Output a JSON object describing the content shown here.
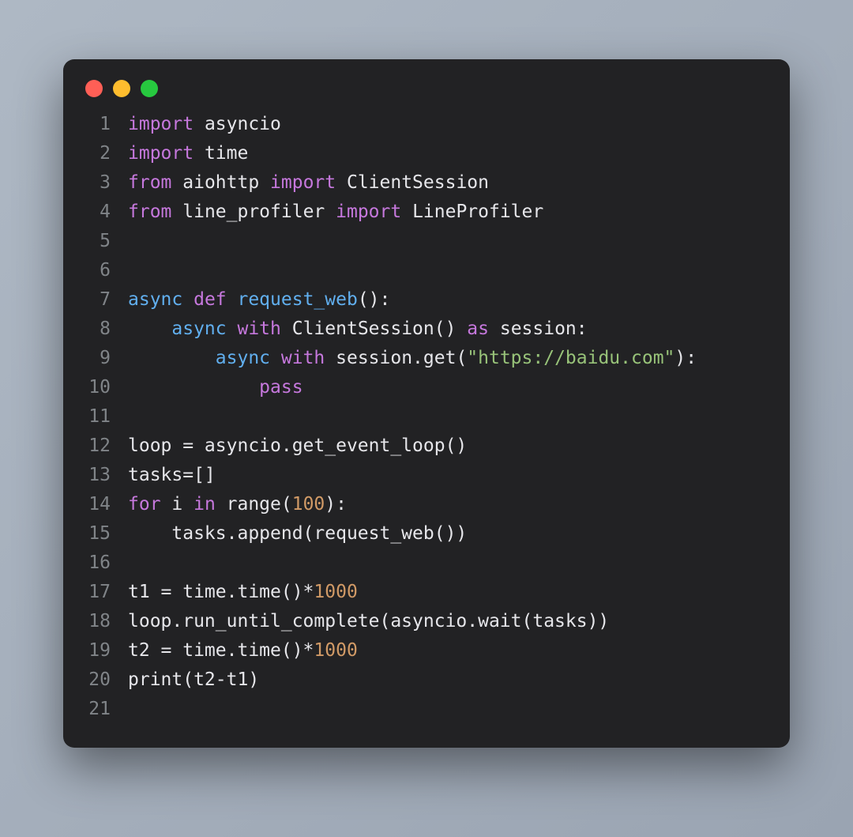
{
  "window": {
    "buttons": [
      "close",
      "minimize",
      "zoom"
    ]
  },
  "lines": [
    {
      "n": "1",
      "tokens": [
        [
          "import ",
          "kw2"
        ],
        [
          "asyncio",
          "name"
        ]
      ]
    },
    {
      "n": "2",
      "tokens": [
        [
          "import ",
          "kw2"
        ],
        [
          "time",
          "name"
        ]
      ]
    },
    {
      "n": "3",
      "tokens": [
        [
          "from ",
          "kw2"
        ],
        [
          "aiohttp ",
          "name"
        ],
        [
          "import ",
          "kw2"
        ],
        [
          "ClientSession",
          "name"
        ]
      ]
    },
    {
      "n": "4",
      "tokens": [
        [
          "from ",
          "kw2"
        ],
        [
          "line_profiler ",
          "name"
        ],
        [
          "import ",
          "kw2"
        ],
        [
          "LineProfiler",
          "name"
        ]
      ]
    },
    {
      "n": "5",
      "tokens": [
        [
          "",
          "name"
        ]
      ]
    },
    {
      "n": "6",
      "tokens": [
        [
          "",
          "name"
        ]
      ]
    },
    {
      "n": "7",
      "tokens": [
        [
          "async ",
          "async"
        ],
        [
          "def ",
          "kw2"
        ],
        [
          "request_web",
          "fn"
        ],
        [
          "():",
          "pun"
        ]
      ]
    },
    {
      "n": "8",
      "tokens": [
        [
          "    ",
          "name"
        ],
        [
          "async ",
          "async"
        ],
        [
          "with ",
          "kw2"
        ],
        [
          "ClientSession() ",
          "name"
        ],
        [
          "as ",
          "kw2"
        ],
        [
          "session:",
          "name"
        ]
      ]
    },
    {
      "n": "9",
      "tokens": [
        [
          "        ",
          "name"
        ],
        [
          "async ",
          "async"
        ],
        [
          "with ",
          "kw2"
        ],
        [
          "session.get(",
          "name"
        ],
        [
          "\"https://baidu.com\"",
          "str"
        ],
        [
          "):",
          "pun"
        ]
      ]
    },
    {
      "n": "10",
      "tokens": [
        [
          "            ",
          "name"
        ],
        [
          "pass",
          "kw2"
        ]
      ]
    },
    {
      "n": "11",
      "tokens": [
        [
          "",
          "name"
        ]
      ]
    },
    {
      "n": "12",
      "tokens": [
        [
          "loop = asyncio.get_event_loop()",
          "name"
        ]
      ]
    },
    {
      "n": "13",
      "tokens": [
        [
          "tasks=[]",
          "name"
        ]
      ]
    },
    {
      "n": "14",
      "tokens": [
        [
          "for ",
          "kw2"
        ],
        [
          "i ",
          "name"
        ],
        [
          "in ",
          "kw2"
        ],
        [
          "range(",
          "name"
        ],
        [
          "100",
          "num"
        ],
        [
          "):",
          "pun"
        ]
      ]
    },
    {
      "n": "15",
      "tokens": [
        [
          "    tasks.append(request_web())",
          "name"
        ]
      ]
    },
    {
      "n": "16",
      "tokens": [
        [
          "",
          "name"
        ]
      ]
    },
    {
      "n": "17",
      "tokens": [
        [
          "t1 = time.time()*",
          "name"
        ],
        [
          "1000",
          "num"
        ]
      ]
    },
    {
      "n": "18",
      "tokens": [
        [
          "loop.run_until_complete(asyncio.wait(tasks))",
          "name"
        ]
      ]
    },
    {
      "n": "19",
      "tokens": [
        [
          "t2 = time.time()*",
          "name"
        ],
        [
          "1000",
          "num"
        ]
      ]
    },
    {
      "n": "20",
      "tokens": [
        [
          "print(t2-t1)",
          "name"
        ]
      ]
    },
    {
      "n": "21",
      "tokens": [
        [
          "",
          "name"
        ]
      ]
    }
  ]
}
